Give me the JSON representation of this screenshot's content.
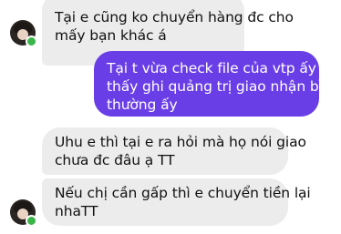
{
  "conversation": {
    "messages": [
      {
        "sender": "them",
        "lines": [
          "Tại e cũng ko chuyển hàng đc cho",
          "mấy bạn khác á"
        ]
      },
      {
        "sender": "me",
        "lines": [
          "Tại t vừa check file của vtp ấy thì",
          "thấy ghi quảng trị giao nhận bình",
          "thường ấy"
        ]
      },
      {
        "sender": "them",
        "lines": [
          "Uhu e thì tại e ra hỏi mà họ nói giao",
          "chưa đc đâu ạ TT"
        ]
      },
      {
        "sender": "them",
        "lines": [
          "Nếu chị cần gấp thì e chuyển tiền lại",
          "nhaTT"
        ]
      }
    ]
  },
  "colors": {
    "incoming_bubble": "#ececec",
    "outgoing_bubble": "#6a3ee6",
    "online_dot": "#3ab54a"
  },
  "icons": {
    "avatar": "contact-avatar",
    "presence": "online-status-dot"
  }
}
